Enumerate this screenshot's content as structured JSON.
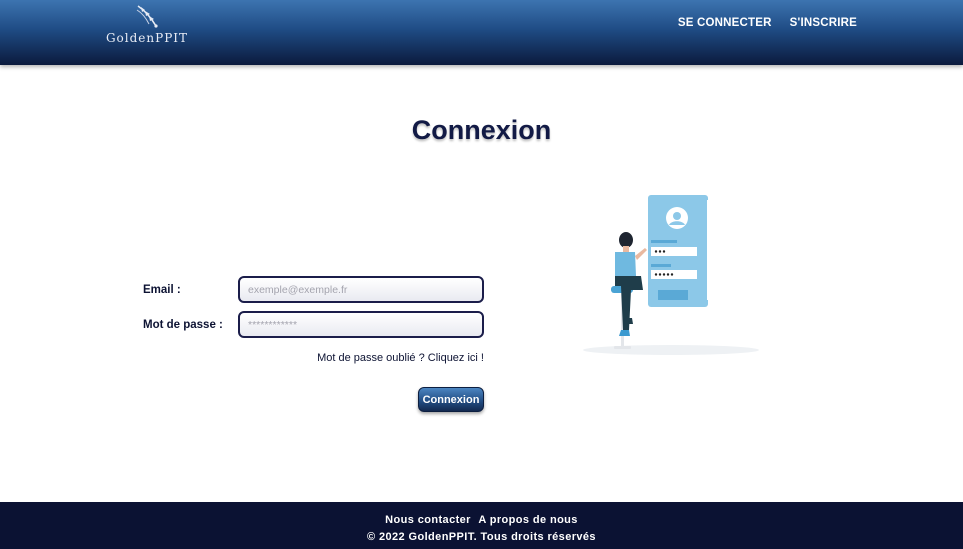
{
  "header": {
    "logo_text": "GoldenPPIT",
    "nav": {
      "login": "SE CONNECTER",
      "register": "S'INSCRIRE"
    }
  },
  "main": {
    "title": "Connexion",
    "form": {
      "email_label": "Email :",
      "email_placeholder": "exemple@exemple.fr",
      "password_label": "Mot de passe :",
      "password_placeholder": "************",
      "forgot_link": "Mot de passe oublié ? Cliquez ici !",
      "submit_label": "Connexion"
    }
  },
  "footer": {
    "contact": "Nous contacter",
    "about": "A propos de nous",
    "copyright": "© 2022 GoldenPPIT. Tous droits réservés"
  },
  "colors": {
    "header_top": "#3d74b0",
    "header_bottom": "#0b1a3d",
    "title": "#121a45",
    "footer": "#0b1233",
    "illustration_blue": "#8cc8e8"
  }
}
